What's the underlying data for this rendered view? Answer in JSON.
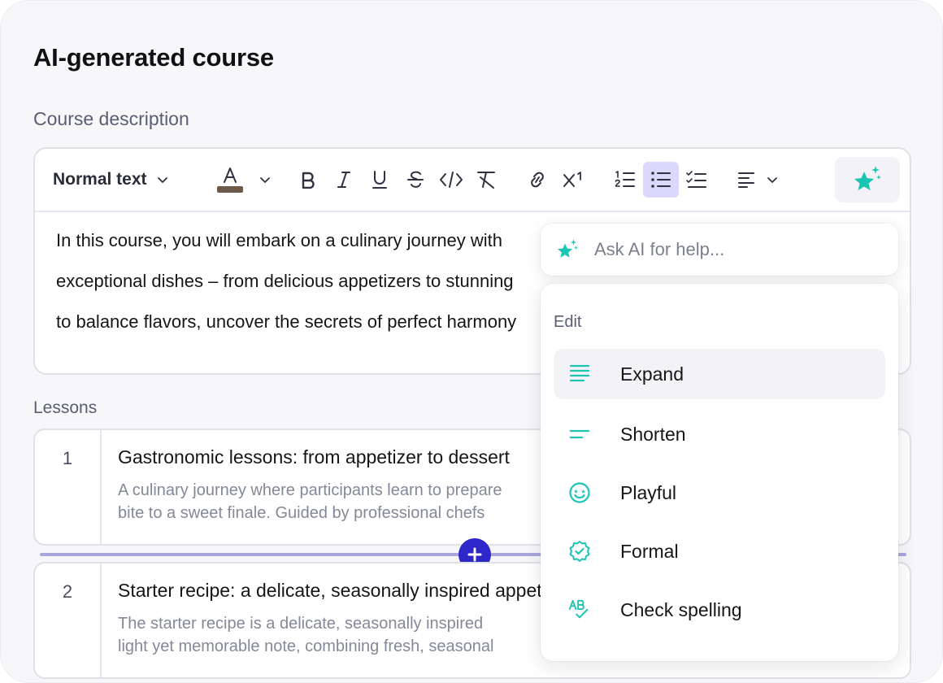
{
  "page": {
    "title": "AI-generated course"
  },
  "description": {
    "label": "Course description",
    "toolbar": {
      "text_style": "Normal text"
    },
    "body_lines": [
      "In this course, you will embark on a culinary journey with",
      "exceptional dishes – from delicious appetizers to stunning",
      "to balance flavors, uncover the secrets of perfect harmony"
    ]
  },
  "lessons": {
    "label": "Lessons",
    "items": [
      {
        "number": "1",
        "title": "Gastronomic lessons: from appetizer to dessert",
        "desc_lines": [
          "A culinary journey where participants learn to prepare",
          "bite to a sweet finale. Guided by professional chefs"
        ]
      },
      {
        "number": "2",
        "title": "Starter recipe: a delicate, seasonally inspired appetizer",
        "desc_lines": [
          "The starter recipe is a delicate, seasonally inspired",
          "light yet memorable note, combining fresh, seasonal"
        ]
      }
    ]
  },
  "ai": {
    "ask_placeholder": "Ask AI for help...",
    "menu_heading": "Edit",
    "items": [
      {
        "label": "Expand",
        "icon": "expand-lines-icon"
      },
      {
        "label": "Shorten",
        "icon": "shorten-lines-icon"
      },
      {
        "label": "Playful",
        "icon": "smiley-face-icon"
      },
      {
        "label": "Formal",
        "icon": "verified-badge-icon"
      },
      {
        "label": "Check spelling",
        "icon": "spell-check-icon"
      }
    ]
  },
  "colors": {
    "accent": "#2d27c9",
    "ai_teal": "#1cc5b3",
    "active_bg": "#dcd8fb",
    "text_color_swatch": "#6b5a4a"
  }
}
